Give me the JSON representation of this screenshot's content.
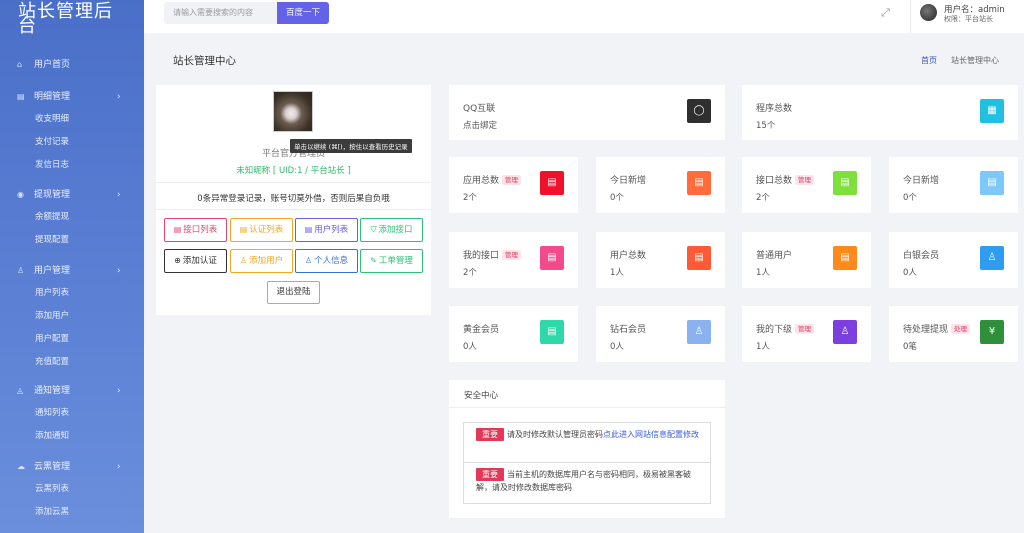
{
  "sidebar": {
    "logo": "站长管理后台",
    "menu": [
      {
        "label": "用户首页",
        "icon": "home-icon",
        "sub": []
      },
      {
        "label": "明细管理",
        "icon": "list-icon",
        "sub": [
          "收支明细",
          "支付记录",
          "发信日志"
        ]
      },
      {
        "label": "提现管理",
        "icon": "wallet-icon",
        "sub": [
          "余额提现",
          "提现配置"
        ]
      },
      {
        "label": "用户管理",
        "icon": "user-icon",
        "sub": [
          "用户列表",
          "添加用户",
          "用户配置",
          "充值配置"
        ]
      },
      {
        "label": "通知管理",
        "icon": "bell-icon",
        "sub": [
          "通知列表",
          "添加通知"
        ]
      },
      {
        "label": "云黑管理",
        "icon": "cloud-icon",
        "sub": [
          "云黑列表",
          "添加云黑"
        ]
      }
    ]
  },
  "topbar": {
    "search_placeholder": "请输入需要搜索的内容",
    "search_button": "百度一下",
    "user_name": "用户名：admin",
    "user_role": "权限：平台站长"
  },
  "page": {
    "title": "站长管理中心",
    "breadcrumb_home": "首页",
    "breadcrumb_current": "站长管理中心"
  },
  "profile": {
    "tooltip": "单击以继续 (⌘[)，按住以查看历史记录",
    "name": "平台官方管理员",
    "nickname": "未知昵称 [ UID:1 / 平台站长 ]",
    "notice": "0条异常登录记录，账号切莫外借，否则后果自负哦",
    "buttons": [
      {
        "label": "接口列表",
        "icon": "doc-icon",
        "color": "#e8436c"
      },
      {
        "label": "认证列表",
        "icon": "doc-icon",
        "color": "#f5a623"
      },
      {
        "label": "用户列表",
        "icon": "doc-icon",
        "color": "#6c5ce7"
      },
      {
        "label": "添加接口",
        "icon": "shield-icon",
        "color": "#2bbf77"
      },
      {
        "label": "添加认证",
        "icon": "plus-circle-icon",
        "color": "#333333"
      },
      {
        "label": "添加用户",
        "icon": "user-icon",
        "color": "#f5a623"
      },
      {
        "label": "个人信息",
        "icon": "user-icon",
        "color": "#3a6fd8"
      },
      {
        "label": "工单管理",
        "icon": "edit-icon",
        "color": "#2bbf77"
      }
    ],
    "logout": "退出登陆"
  },
  "stats": {
    "qq": {
      "label": "QQ互联",
      "value": "点击绑定",
      "color": "#2f2f2f"
    },
    "programs": {
      "label": "程序总数",
      "value": "15个",
      "color": "#20c0e0"
    },
    "apps": {
      "label": "应用总数",
      "badge": "管理",
      "value": "2个",
      "color": "#f2112a"
    },
    "today_new_1": {
      "label": "今日新增",
      "value": "0个",
      "color": "#ff6b3a"
    },
    "interfaces": {
      "label": "接口总数",
      "badge": "管理",
      "value": "2个",
      "color": "#7ee03a"
    },
    "today_new_2": {
      "label": "今日新增",
      "value": "0个",
      "color": "#7cc8f8"
    },
    "my_interfaces": {
      "label": "我的接口",
      "badge": "管理",
      "value": "2个",
      "color": "#f24b8c"
    },
    "users": {
      "label": "用户总数",
      "value": "1人",
      "color": "#ff5a36"
    },
    "normal_users": {
      "label": "普通用户",
      "value": "1人",
      "color": "#ff8a1a"
    },
    "silver": {
      "label": "白银会员",
      "value": "0人",
      "color": "#2f9cf0"
    },
    "gold": {
      "label": "黄金会员",
      "value": "0人",
      "color": "#2fd8a8"
    },
    "diamond": {
      "label": "钻石会员",
      "value": "0人",
      "color": "#8ab2f0"
    },
    "subordinates": {
      "label": "我的下级",
      "badge": "管理",
      "value": "1人",
      "color": "#7b3fe0"
    },
    "pending": {
      "label": "待处理提现",
      "badge": "处理",
      "value": "0笔",
      "color": "#2f8f3a"
    }
  },
  "security": {
    "title": "安全中心",
    "tag": "重要",
    "item1_text": "请及时修改默认管理员密码",
    "item1_link": "点此进入网站信息配置修改",
    "item2_text": "当前主机的数据库用户名与密码相同，极易被黑客破解，请及时修改数据库密码"
  }
}
